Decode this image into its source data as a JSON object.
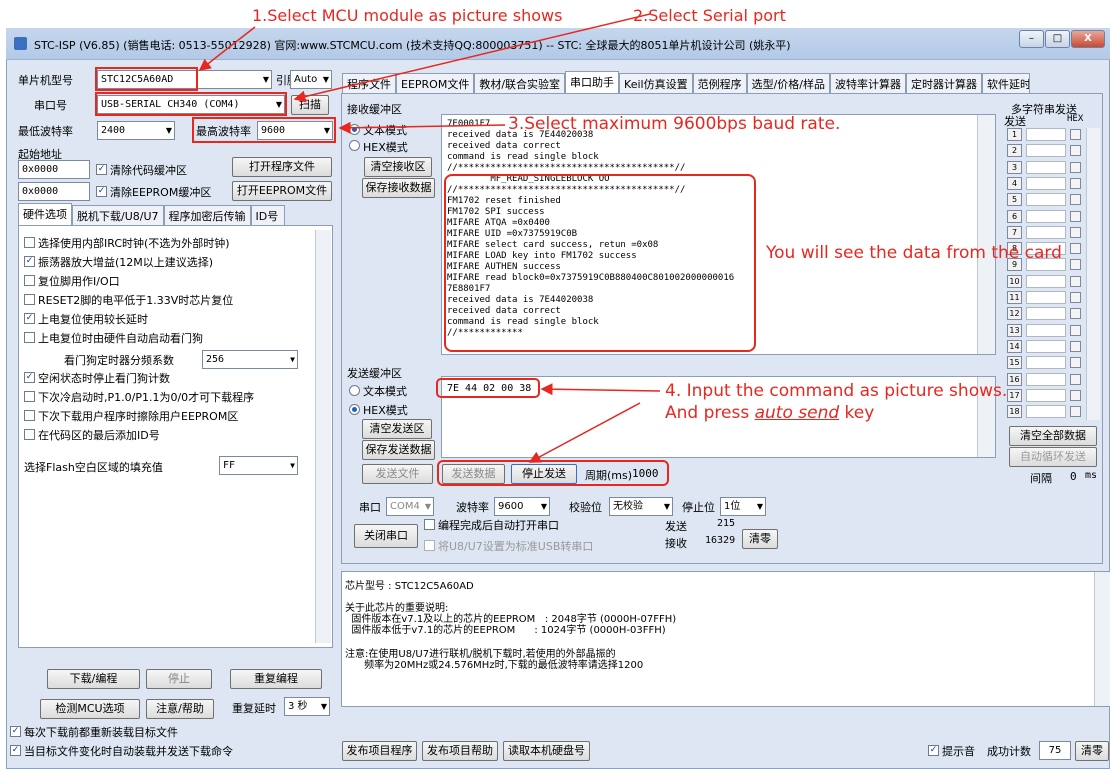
{
  "annotations": {
    "a1": "1.Select MCU module as picture shows",
    "a2": "2.Select Serial port",
    "a3": "3.Select maximum 9600bps baud rate.",
    "a4a": "You will see the data from the card",
    "a4b": "4. Input the command as picture shows.",
    "a4c": "And press ",
    "a4d": "auto send",
    "a4e": " key"
  },
  "window": {
    "title": "STC-ISP (V6.85) (销售电话: 0513-55012928) 官网:www.STCMCU.com (技术支持QQ:800003751) -- STC: 全球最大的8051单片机设计公司 (姚永平)",
    "min": "–",
    "max": "□",
    "close": "X"
  },
  "left": {
    "mcu_label": "单片机型号",
    "mcu_value": "STC12C5A60AD",
    "pins_label": "引脚数",
    "pins_value": "Auto",
    "port_label": "串口号",
    "port_value": "USB-SERIAL CH340 (COM4)",
    "scan": "扫描",
    "min_baud_label": "最低波特率",
    "min_baud_value": "2400",
    "max_baud_label": "最高波特率",
    "max_baud_value": "9600",
    "start_addr_label": "起始地址",
    "addr1": "0x0000",
    "clear_code": "清除代码缓冲区",
    "open_prog": "打开程序文件",
    "addr2": "0x0000",
    "clear_eeprom": "清除EEPROM缓冲区",
    "open_eeprom": "打开EEPROM文件",
    "tabs": [
      "硬件选项",
      "脱机下载/U8/U7",
      "程序加密后传输",
      "ID号"
    ],
    "options": [
      {
        "label": "选择使用内部IRC时钟(不选为外部时钟)",
        "checked": false
      },
      {
        "label": "振荡器放大增益(12M以上建议选择)",
        "checked": true
      },
      {
        "label": "复位脚用作I/O口",
        "checked": false
      },
      {
        "label": "RESET2脚的电平低于1.33V时芯片复位",
        "checked": false
      },
      {
        "label": "上电复位使用较长延时",
        "checked": true
      },
      {
        "label": "上电复位时由硬件自动启动看门狗",
        "checked": false
      },
      {
        "label": "空闲状态时停止看门狗计数",
        "checked": true
      },
      {
        "label": "下次冷启动时,P1.0/P1.1为0/0才可下载程序",
        "checked": false
      },
      {
        "label": "下次下载用户程序时擦除用户EEPROM区",
        "checked": false
      },
      {
        "label": "在代码区的最后添加ID号",
        "checked": false
      }
    ],
    "wdt_label": "看门狗定时器分频系数",
    "wdt_value": "256",
    "fill_label": "选择Flash空白区域的填充值",
    "fill_value": "FF",
    "download": "下载/编程",
    "stop": "停止",
    "reprogram": "重复编程",
    "check_mcu": "检测MCU选项",
    "help": "注意/帮助",
    "delay_label": "重复延时",
    "delay_value": "3 秒",
    "reload1": "每次下载前都重新装载目标文件",
    "reload2": "当目标文件变化时自动装载并发送下载命令"
  },
  "right_tabs": [
    "程序文件",
    "EEPROM文件",
    "教材/联合实验室",
    "串口助手",
    "Keil仿真设置",
    "范例程序",
    "选型/价格/样品",
    "波特率计算器",
    "定时器计算器",
    "软件延时计"
  ],
  "rx": {
    "group": "接收缓冲区",
    "text_mode": "文本模式",
    "hex_mode": "HEX模式",
    "clear": "清空接收区",
    "save": "保存接收数据",
    "lines": "7E0001F7\nreceived data is 7E44020038\nreceived data correct\ncommand is read single block\n//****************************************//\n        MF_READ_SINGLEBLOCK OO\n//****************************************//\nFM1702 reset finished\nFM1702 SPI success\nMIFARE ATQA =0x0400\nMIFARE UID =0x7375919C0B\nMIFARE select card success, retun =0x08\nMIFARE LOAD key into FM1702 success\nMIFARE AUTHEN success\nMIFARE read block0=0x7375919C0B880400C801002000000016\n7E8801F7\nreceived data is 7E44020038\nreceived data correct\ncommand is read single block\n//************"
  },
  "tx": {
    "group": "发送缓冲区",
    "text_mode": "文本模式",
    "hex_mode": "HEX模式",
    "clear": "清空发送区",
    "save": "保存发送数据",
    "command": "7E 44 02 00 38",
    "send_file": "发送文件",
    "send_data": "发送数据",
    "stop_send": "停止发送",
    "period_label": "周期(ms)",
    "period_value": "1000"
  },
  "serial": {
    "port_label": "串口",
    "port_value": "COM4",
    "baud_label": "波特率",
    "baud_value": "9600",
    "parity_label": "校验位",
    "parity_value": "无校验",
    "stop_label": "停止位",
    "stop_value": "1位",
    "close_port": "关闭串口",
    "auto_open": "编程完成后自动打开串口",
    "usb_cdc": "将U8/U7设置为标准USB转串口",
    "send_label": "发送",
    "send_count": "215",
    "recv_label": "接收",
    "recv_count": "16329",
    "clear": "清零"
  },
  "multi": {
    "title": "多字符串发送",
    "send_col": "发送",
    "hex_col": "HEX",
    "nums": [
      "1",
      "2",
      "3",
      "4",
      "5",
      "6",
      "7",
      "8",
      "9",
      "10",
      "11",
      "12",
      "13",
      "14",
      "15",
      "16",
      "17",
      "18"
    ],
    "clear_all": "清空全部数据",
    "auto_loop": "自动循环发送",
    "interval_label": "间隔",
    "interval_value": "0",
    "interval_unit": "ms"
  },
  "info": {
    "chip_line": "芯片型号 : STC12C5A60AD",
    "note_title": "关于此芯片的重要说明:",
    "note1": "  固件版本在v7.1及以上的芯片的EEPROM   : 2048字节 (0000H-07FFH)",
    "note2": "  固件版本低于v7.1的芯片的EEPROM      : 1024字节 (0000H-03FFH)",
    "note3": "注意:在使用U8/U7进行联机/脱机下载时,若使用的外部晶振的",
    "note4": "      频率为20MHz或24.576MHz时,下载的最低波特率请选择1200"
  },
  "bottom": {
    "publish_prog": "发布项目程序",
    "publish_help": "发布项目帮助",
    "read_disk": "读取本机硬盘号",
    "sound": "提示音",
    "success_label": "成功计数",
    "success_count": "75",
    "clear": "清零"
  },
  "colors": {
    "annotation": "#e8271f",
    "window_bg": "#dde6f2"
  }
}
